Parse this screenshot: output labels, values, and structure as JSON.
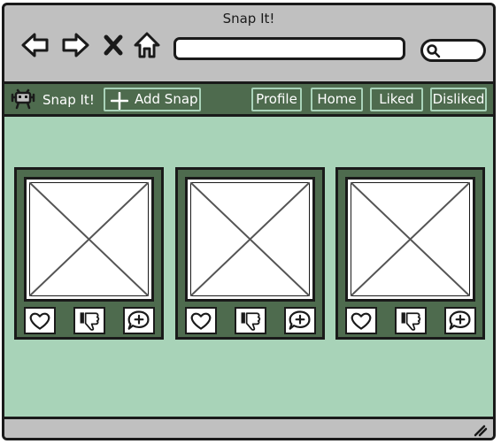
{
  "window": {
    "title": "Snap It!"
  },
  "browser": {
    "url_value": "",
    "icons": [
      "back-arrow-icon",
      "forward-arrow-icon",
      "close-x-icon",
      "home-icon",
      "search-icon"
    ]
  },
  "app": {
    "brand": "Snap It!",
    "logo_icon": "robot-bug-icon",
    "add_snap_label": "Add Snap",
    "nav": {
      "profile": "Profile",
      "home": "Home",
      "liked": "Liked",
      "disliked": "Disliked"
    }
  },
  "cards": [
    {
      "image": "image-placeholder",
      "actions": [
        "heart-icon",
        "dislike-icon",
        "comment-add-icon"
      ]
    },
    {
      "image": "image-placeholder",
      "actions": [
        "heart-icon",
        "dislike-icon",
        "comment-add-icon"
      ]
    },
    {
      "image": "image-placeholder",
      "actions": [
        "heart-icon",
        "dislike-icon",
        "comment-add-icon"
      ]
    }
  ],
  "colors": {
    "window_chrome": "#c0c0c0",
    "app_nav": "#4e6b4e",
    "content_bg": "#a8d3b8",
    "pill_border": "#a9d3b9",
    "outline": "#1a1a1a"
  }
}
